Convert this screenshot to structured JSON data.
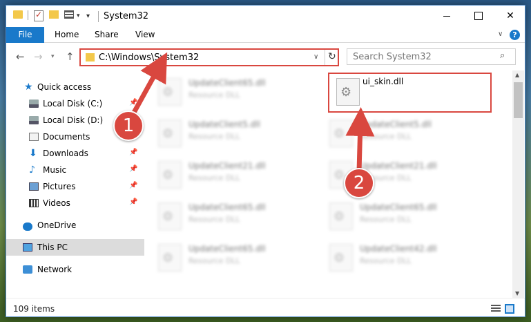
{
  "window": {
    "title": "System32"
  },
  "ribbon": {
    "tabs": [
      "File",
      "Home",
      "Share",
      "View"
    ],
    "help": "?"
  },
  "nav": {
    "address": "C:\\Windows\\System32",
    "search_placeholder": "Search System32"
  },
  "sidebar": {
    "items": [
      {
        "label": "Quick access",
        "pinned": false
      },
      {
        "label": "Local Disk (C:)",
        "pinned": true
      },
      {
        "label": "Local Disk (D:)",
        "pinned": false
      },
      {
        "label": "Documents",
        "pinned": false
      },
      {
        "label": "Downloads",
        "pinned": true
      },
      {
        "label": "Music",
        "pinned": true
      },
      {
        "label": "Pictures",
        "pinned": true
      },
      {
        "label": "Videos",
        "pinned": true
      },
      {
        "label": "OneDrive",
        "pinned": false
      },
      {
        "label": "This PC",
        "pinned": false,
        "selected": true
      },
      {
        "label": "Network",
        "pinned": false
      }
    ]
  },
  "files": {
    "left": [
      {
        "name": "UpdateClient65.dll",
        "type": "Resource DLL"
      },
      {
        "name": "UpdateClient5.dll",
        "type": "Resource DLL"
      },
      {
        "name": "UpdateClient21.dll",
        "type": "Resource DLL"
      },
      {
        "name": "UpdateClient65.dll",
        "type": "Resource DLL"
      },
      {
        "name": "UpdateClient65.dll",
        "type": "Resource DLL"
      }
    ],
    "right": [
      {
        "name": "ui_skin.dll",
        "type": ""
      },
      {
        "name": "UpdateClient5.dll",
        "type": "Resource DLL"
      },
      {
        "name": "UpdateClient21.dll",
        "type": "Resource DLL"
      },
      {
        "name": "UpdateClient65.dll",
        "type": "Resource DLL"
      },
      {
        "name": "UpdateClient42.dll",
        "type": "Resource DLL"
      }
    ]
  },
  "status": {
    "items": "109 items"
  },
  "annotations": {
    "step1": "1",
    "step2": "2"
  },
  "colors": {
    "accent": "#1979ca",
    "highlight": "#d9473f"
  }
}
